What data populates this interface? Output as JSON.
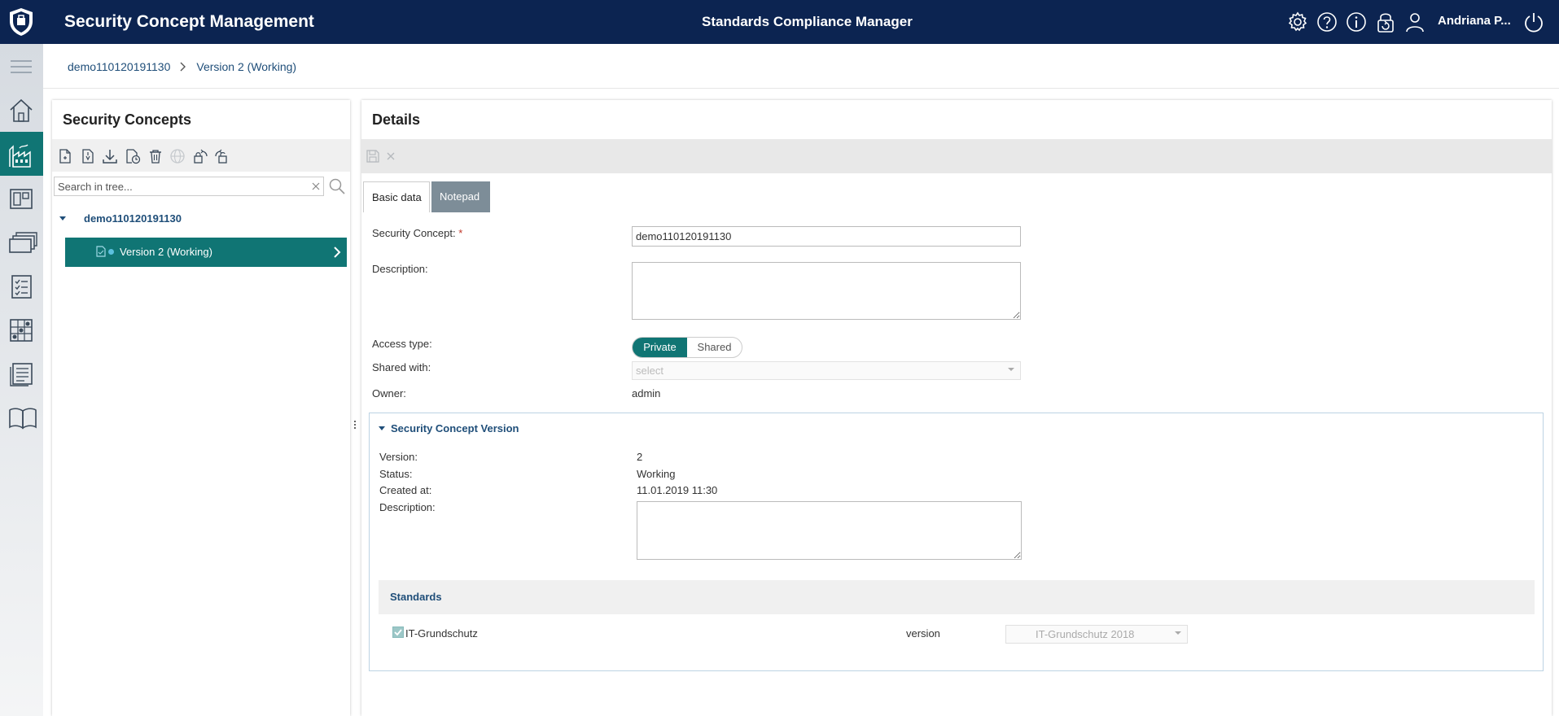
{
  "header": {
    "app_title": "Security Concept Management",
    "center_title": "Standards Compliance Manager",
    "user_name": "Andriana P...",
    "icons": [
      "gear-icon",
      "help-icon",
      "info-icon",
      "lock-refresh-icon",
      "user-icon",
      "power-icon"
    ]
  },
  "rail": {
    "items": [
      "menu-icon",
      "home-icon",
      "factory-icon",
      "board-icon",
      "cards-icon",
      "checklist-icon",
      "grid-chart-icon",
      "report-icon",
      "book-icon"
    ],
    "active_item": "factory-icon"
  },
  "breadcrumb": {
    "items": [
      "demo110120191130",
      "Version 2 (Working)"
    ]
  },
  "left_panel": {
    "title": "Security Concepts",
    "toolbar_icons": [
      "new-file-icon",
      "new-version-icon",
      "download-icon",
      "file-clock-icon",
      "trash-icon",
      "globe-icon",
      "lock-rotate-icon",
      "unlock-rotate-icon"
    ],
    "search_placeholder": "Search in tree...",
    "tree": {
      "root_label": "demo110120191130",
      "child_label": "Version 2 (Working)"
    }
  },
  "details": {
    "title": "Details",
    "toolbar_icons": [
      "save-icon",
      "close-icon"
    ],
    "tabs": [
      "Basic data",
      "Notepad"
    ],
    "active_tab": "Basic data",
    "fields": {
      "security_concept_label": "Security Concept:",
      "required_mark": "*",
      "security_concept_value": "demo110120191130",
      "description_label": "Description:",
      "description_value": "",
      "access_type_label": "Access type:",
      "access_options": [
        "Private",
        "Shared"
      ],
      "access_selected": "Private",
      "shared_with_label": "Shared with:",
      "shared_with_placeholder": "select",
      "owner_label": "Owner:",
      "owner_value": "admin"
    },
    "version_section": {
      "title": "Security Concept Version",
      "version_label": "Version:",
      "version_value": "2",
      "status_label": "Status:",
      "status_value": "Working",
      "created_label": "Created at:",
      "created_value": "11.01.2019 11:30",
      "description_label": "Description:",
      "description_value": "",
      "standards": {
        "title": "Standards",
        "rows": [
          {
            "name": "IT-Grundschutz",
            "checked": true,
            "version_label": "version",
            "version_value": "IT-Grundschutz 2018"
          }
        ]
      }
    }
  },
  "colors": {
    "header_bg": "#0c2451",
    "accent_teal": "#107574",
    "link_blue": "#1f4e79",
    "required_red": "#c0392b",
    "notepad_tab": "#7d8d98"
  }
}
